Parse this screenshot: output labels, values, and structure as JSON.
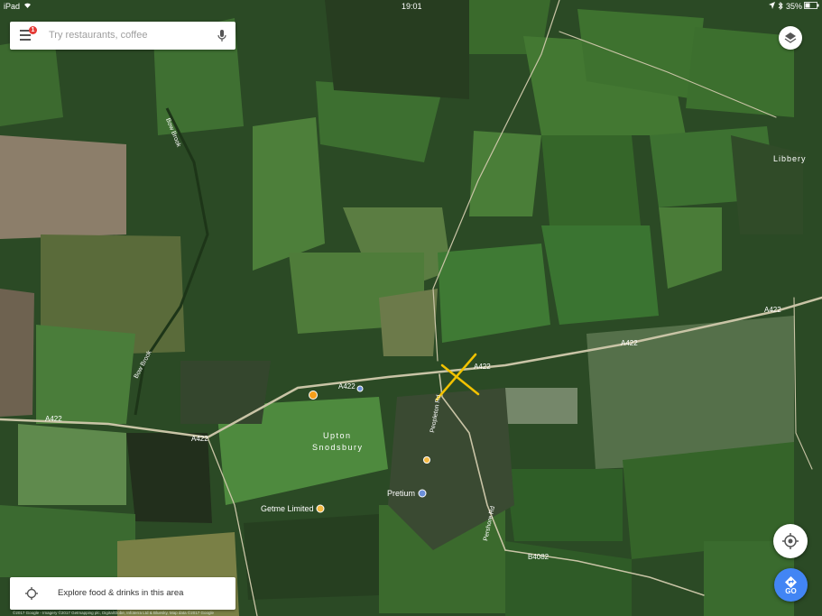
{
  "status_bar": {
    "device": "iPad",
    "time": "19:01",
    "battery": "35%"
  },
  "search": {
    "placeholder": "Try restaurants, coffee",
    "notification_count": "1"
  },
  "explore": {
    "label": "Explore food & drinks in this area"
  },
  "go_button": {
    "label": "GO"
  },
  "map_labels": {
    "libbery": "Libbery",
    "upton": "Upton",
    "snodsbury": "Snodsbury",
    "bow_brook_1": "Bow Brook",
    "bow_brook_2": "Bow Brook",
    "pretium": "Pretium",
    "getme": "Getme Limited",
    "peopleton_rd": "Peopleton Rd",
    "pershore_rd": "Pershore Rd",
    "b4082": "B4082"
  },
  "road_labels": {
    "a422_west": "A422",
    "a422_west2": "A422",
    "a422_village": "A422",
    "a422_cross": "A422",
    "a422_east": "A422",
    "a422_far_east": "A422"
  },
  "copyright": "©2017 Google - Imagery ©2017 Getmapping plc, DigitalGlobe, Infoterra Ltd & Bluesky, Map data ©2017 Google",
  "colors": {
    "accent": "#4285f4",
    "badge": "#e53935",
    "marker": "#f5b942",
    "cross": "#f2c200"
  },
  "icons": [
    "wifi-icon",
    "location-arrow-icon",
    "bluetooth-icon",
    "battery-icon",
    "menu-icon",
    "mic-icon",
    "layers-icon",
    "my-location-icon",
    "navigation-icon",
    "explore-icon"
  ]
}
